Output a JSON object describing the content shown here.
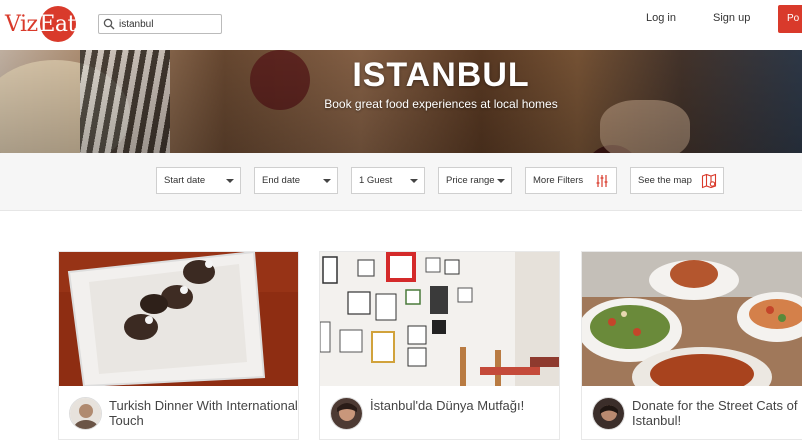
{
  "brand": {
    "part1": "Viz",
    "part2": "Eat"
  },
  "search": {
    "value": "istanbul"
  },
  "nav": {
    "login": "Log in",
    "signup": "Sign up",
    "cta": "Po"
  },
  "hero": {
    "title": "ISTANBUL",
    "subtitle": "Book great food experiences at local homes"
  },
  "filters": {
    "start_date": "Start date",
    "end_date": "End date",
    "guests": "1 Guest",
    "price": "Price range",
    "more": "More Filters",
    "map": "See the map"
  },
  "cards": [
    {
      "title": "Turkish Dinner With International Touch"
    },
    {
      "title": "İstanbul'da Dünya Mutfağı!"
    },
    {
      "title": "Donate for the Street Cats of Istanbul!"
    }
  ],
  "colors": {
    "brand": "#d93a2b",
    "filter_bg": "#f6f6f6"
  }
}
